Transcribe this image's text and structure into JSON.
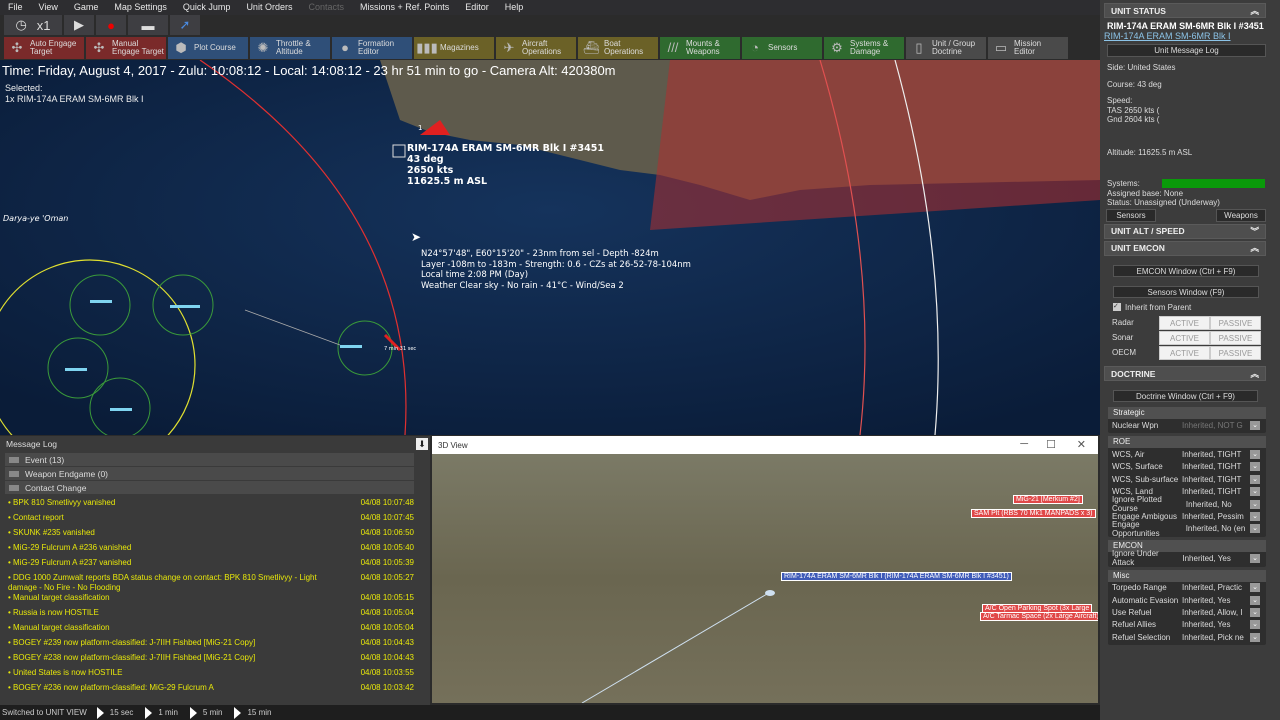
{
  "menu": [
    "File",
    "View",
    "Game",
    "Map Settings",
    "Quick Jump",
    "Unit Orders",
    "Contacts",
    "Missions + Ref. Points",
    "Editor",
    "Help"
  ],
  "controls": {
    "speed": "x1",
    "clock_icon": "clock-icon",
    "play_icon": "play-icon",
    "record_icon": "record-icon",
    "flat_icon": "terrain-icon",
    "arrow_icon": "arrow-icon"
  },
  "toolbar": [
    {
      "l1": "Auto Engage",
      "l2": "Target",
      "color": "#7a2a2a",
      "icon": "✣"
    },
    {
      "l1": "Manual",
      "l2": "Engage Target",
      "color": "#7a2a2a",
      "icon": "✣"
    },
    {
      "l1": "Plot Course",
      "l2": "",
      "color": "#2f4f78",
      "icon": "⬢"
    },
    {
      "l1": "Throttle &",
      "l2": "Altitude",
      "color": "#2f4f78",
      "icon": "✺"
    },
    {
      "l1": "Formation",
      "l2": "Editor",
      "color": "#2f4f78",
      "icon": "●"
    },
    {
      "l1": "Magazines",
      "l2": "",
      "color": "#6b6127",
      "icon": "▮▮▮"
    },
    {
      "l1": "Aircraft",
      "l2": "Operations",
      "color": "#6b6127",
      "icon": "✈"
    },
    {
      "l1": "Boat",
      "l2": "Operations",
      "color": "#6b6127",
      "icon": "⛴"
    },
    {
      "l1": "Mounts &",
      "l2": "Weapons",
      "color": "#2f6a2f",
      "icon": "///"
    },
    {
      "l1": "Sensors",
      "l2": "",
      "color": "#2f6a2f",
      "icon": "◔"
    },
    {
      "l1": "Systems &",
      "l2": "Damage",
      "color": "#2f6a2f",
      "icon": "⚙"
    },
    {
      "l1": "Unit / Group",
      "l2": "Doctrine",
      "color": "#4a4a4a",
      "icon": "▯"
    },
    {
      "l1": "Mission",
      "l2": "Editor",
      "color": "#4a4a4a",
      "icon": "▭"
    }
  ],
  "map": {
    "time": "Time: Friday, August 4, 2017 - Zulu: 10:08:12 - Local: 14:08:12 - 23 hr 51 min to go -  Camera Alt: 420380m",
    "selected_label": "Selected:",
    "selected_unit": "1x RIM-174A ERAM SM-6MR Blk I",
    "place": "Darya-ye 'Oman",
    "unit": {
      "name": "RIM-174A ERAM SM-6MR Blk I #3451",
      "course": "43 deg",
      "speed": "2650 kts",
      "alt": "11625.5 m ASL"
    },
    "unit_count": "1",
    "small_label": "7 min 31 sec",
    "hover": [
      "N24°57'48\", E60°15'20\" - 23nm from sel - Depth -824m",
      "Layer -108m to -183m - Strength: 0.6 - CZs at 26-52-78-104nm",
      "Local time 2:08 PM (Day)",
      "Weather Clear sky - No rain - 41°C - Wind/Sea 2"
    ],
    "colors": {
      "ocean": "#0e2446",
      "land": "#5e5a4c",
      "hostile_zone": "#b03030",
      "range_ring": "#e03030",
      "friendly": "#7fd4f0"
    }
  },
  "log": {
    "title": "Message Log",
    "groups": [
      {
        "label": "Event (13)"
      },
      {
        "label": "Weapon Endgame (0)"
      },
      {
        "label": "Contact Change"
      }
    ],
    "rows": [
      {
        "text": "BPK 810 Smetlivyy vanished",
        "time": "04/08 10:07:48"
      },
      {
        "text": "Contact report",
        "time": "04/08 10:07:45"
      },
      {
        "text": "SKUNK #235 vanished",
        "time": "04/08 10:06:50"
      },
      {
        "text": "MiG-29 Fulcrum A #236 vanished",
        "time": "04/08 10:05:40"
      },
      {
        "text": "MiG-29 Fulcrum A #237 vanished",
        "time": "04/08 10:05:39"
      },
      {
        "text": "DDG 1000 Zumwalt reports BDA status change on contact: BPK 810 Smetlivyy - Light damage - No Fire - No Flooding",
        "time": "04/08 10:05:27"
      },
      {
        "text": "Manual target classification",
        "time": "04/08 10:05:15"
      },
      {
        "text": "Russia is now HOSTILE",
        "time": "04/08 10:05:04"
      },
      {
        "text": "Manual target classification",
        "time": "04/08 10:05:04"
      },
      {
        "text": "BOGEY #239 now platform-classified: J-7IIH Fishbed [MiG-21 Copy]",
        "time": "04/08 10:04:43"
      },
      {
        "text": "BOGEY #238 now platform-classified: J-7IIH Fishbed [MiG-21 Copy]",
        "time": "04/08 10:04:43"
      },
      {
        "text": "United States is now HOSTILE",
        "time": "04/08 10:03:55"
      },
      {
        "text": "BOGEY #236 now platform-classified: MiG-29 Fulcrum A",
        "time": "04/08 10:03:42"
      }
    ]
  },
  "view3d": {
    "title": "3D View",
    "labels": {
      "mig": "MiG-21 [Merkum #2]",
      "sam": "SAM Plt (RBS 70 Mk1 MANPADS x 3)",
      "missile": "RIM-174A ERAM SM-6MR Blk I (RIM-174A ERAM SM-6MR Blk I #3451)",
      "parking": "A/C Open Parking Spot (3x Large",
      "tarmac": "A/C Tarmac Space (2x Large Aircraft)"
    }
  },
  "status": {
    "text": "Switched to UNIT VIEW",
    "steps": [
      "15 sec",
      "1 min",
      "5 min",
      "15 min"
    ]
  },
  "right": {
    "unit_status": "UNIT STATUS",
    "unit_name": "RIM-174A ERAM SM-6MR Blk I #3451",
    "unit_class": "RIM-174A ERAM SM-6MR Blk I",
    "msg_log_btn": "Unit Message Log",
    "side": "Side: United States",
    "course": "Course: 43 deg",
    "speed_label": "Speed:",
    "tas": "TAS 2650 kts (",
    "gnd": "Gnd 2604 kts (",
    "altitude": "Altitude: 11625.5 m ASL",
    "systems": "Systems:",
    "systems_health": 1.0,
    "base": "Assigned base: None",
    "status": "Status: Unassigned (Underway)",
    "sensors_btn": "Sensors",
    "weapons_btn": "Weapons",
    "alt_speed": "UNIT ALT / SPEED",
    "emcon": "UNIT EMCON",
    "emcon_btn": "EMCON Window (Ctrl + F9)",
    "sensors_win_btn": "Sensors Window (F9)",
    "inherit": "Inherit from Parent",
    "emcon_rows": [
      {
        "label": "Radar",
        "a": "ACTIVE",
        "p": "PASSIVE"
      },
      {
        "label": "Sonar",
        "a": "ACTIVE",
        "p": "PASSIVE"
      },
      {
        "label": "OECM",
        "a": "ACTIVE",
        "p": "PASSIVE"
      }
    ],
    "doctrine": "DOCTRINE",
    "doctrine_btn": "Doctrine Window (Ctrl + F9)",
    "groups": [
      {
        "title": "Strategic",
        "rows": [
          {
            "k": "Nuclear Wpn",
            "v": "Inherited, NOT G"
          }
        ]
      },
      {
        "title": "ROE",
        "rows": [
          {
            "k": "WCS, Air",
            "v": "Inherited, TIGHT"
          },
          {
            "k": "WCS, Surface",
            "v": "Inherited, TIGHT"
          },
          {
            "k": "WCS, Sub-surface",
            "v": "Inherited, TIGHT"
          },
          {
            "k": "WCS, Land",
            "v": "Inherited, TIGHT"
          },
          {
            "k": "Ignore Plotted Course",
            "v": "Inherited, No"
          },
          {
            "k": "Engage Ambigous",
            "v": "Inherited, Pessim"
          },
          {
            "k": "Engage Opportunities",
            "v": "Inherited, No (en"
          }
        ]
      },
      {
        "title": "EMCON",
        "rows": [
          {
            "k": "Ignore Under Attack",
            "v": "Inherited, Yes"
          }
        ]
      },
      {
        "title": "Misc",
        "rows": [
          {
            "k": "Torpedo Range",
            "v": "Inherited, Practic"
          },
          {
            "k": "Automatic Evasion",
            "v": "Inherited, Yes"
          },
          {
            "k": "Use Refuel",
            "v": "Inherited, Allow, I"
          },
          {
            "k": "Refuel Allies",
            "v": "Inherited, Yes"
          },
          {
            "k": "Refuel Selection",
            "v": "Inherited, Pick ne"
          }
        ]
      }
    ]
  }
}
